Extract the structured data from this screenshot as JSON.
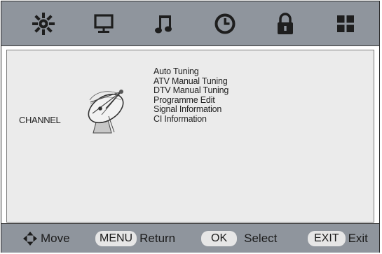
{
  "top_tabs": [
    {
      "icon": "picture-settings-icon"
    },
    {
      "icon": "screen-icon"
    },
    {
      "icon": "music-note-icon"
    },
    {
      "icon": "clock-icon"
    },
    {
      "icon": "lock-icon"
    },
    {
      "icon": "grid-icon"
    }
  ],
  "section": {
    "title": "CHANNEL",
    "icon": "satellite-dish-icon"
  },
  "menu_items": [
    "Auto Tuning",
    "ATV Manual Tuning",
    "DTV Manual Tuning",
    "Programme Edit",
    "Signal Information",
    "CI Information"
  ],
  "footer": {
    "move": {
      "icon": "four-way-arrow-icon",
      "label": "Move"
    },
    "return": {
      "key": "MENU",
      "label": "Return"
    },
    "select": {
      "key": "OK",
      "label": "Select"
    },
    "exit": {
      "key": "EXIT",
      "label": "Exit"
    }
  },
  "colors": {
    "bar": "#8f959d",
    "panel": "#ebebeb",
    "icon": "#1e1e1e",
    "key_bg": "#e6e6e6"
  }
}
